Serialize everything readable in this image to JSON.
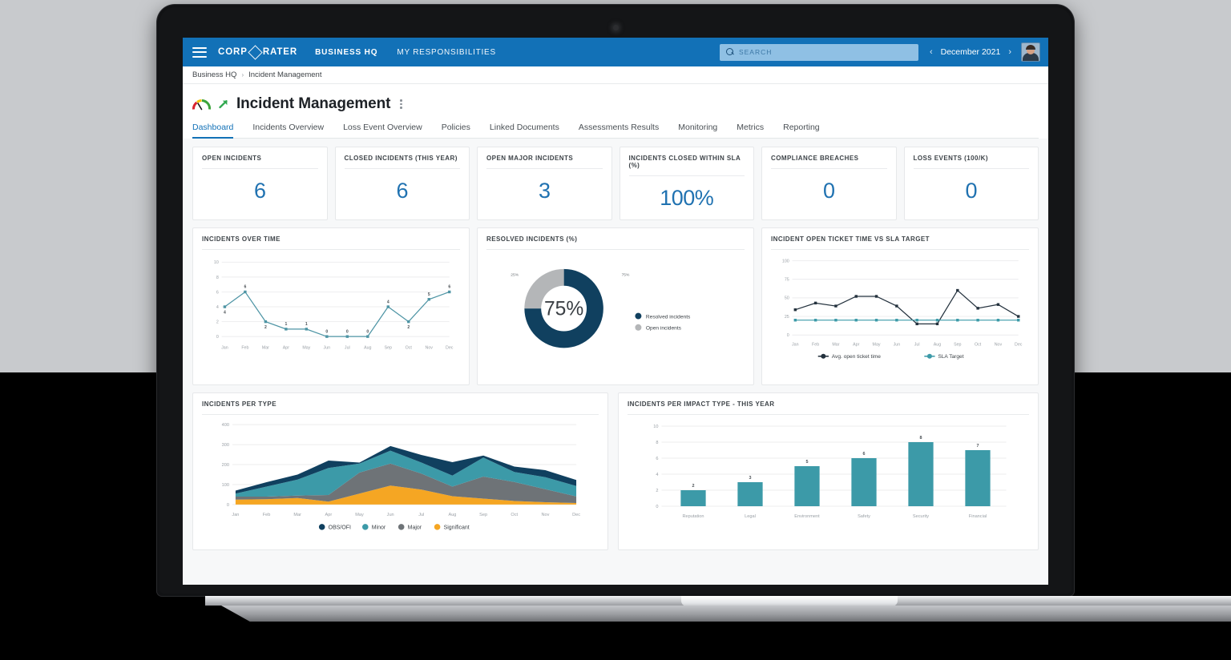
{
  "topbar": {
    "menu_icon": "hamburger-icon",
    "brand": "CORPORATER",
    "nav": [
      {
        "label": "BUSINESS HQ"
      },
      {
        "label": "MY RESPONSIBILITIES"
      }
    ],
    "search": {
      "placeholder": "SEARCH",
      "value": "",
      "icon": "search-icon"
    },
    "period": {
      "prev_icon": "‹",
      "label": "December 2021",
      "next_icon": "›"
    },
    "avatar": "user-avatar"
  },
  "breadcrumb": {
    "root": "Business HQ",
    "separator": "›",
    "current": "Incident Management"
  },
  "header": {
    "title": "Incident Management",
    "gauge_icon": "gauge-icon",
    "trend_icon": "arrow-up-right-icon",
    "menu_icon": "kebab-menu-icon"
  },
  "tabs": [
    {
      "label": "Dashboard",
      "active": true
    },
    {
      "label": "Incidents Overview",
      "active": false
    },
    {
      "label": "Loss Event Overview",
      "active": false
    },
    {
      "label": "Policies",
      "active": false
    },
    {
      "label": "Linked Documents",
      "active": false
    },
    {
      "label": "Assessments Results",
      "active": false
    },
    {
      "label": "Monitoring",
      "active": false
    },
    {
      "label": "Metrics",
      "active": false
    },
    {
      "label": "Reporting",
      "active": false
    }
  ],
  "kpis": [
    {
      "label": "OPEN INCIDENTS",
      "value": "6"
    },
    {
      "label": "CLOSED INCIDENTS (THIS YEAR)",
      "value": "6"
    },
    {
      "label": "OPEN MAJOR INCIDENTS",
      "value": "3"
    },
    {
      "label": "INCIDENTS CLOSED WITHIN SLA (%)",
      "value": "100%"
    },
    {
      "label": "COMPLIANCE BREACHES",
      "value": "0"
    },
    {
      "label": "LOSS EVENTS (100/K)",
      "value": "0"
    }
  ],
  "colors": {
    "brand_blue": "#1271b7",
    "kpi_value": "#2072b1",
    "navy": "#10405f",
    "teal": "#3c9aa8",
    "gray": "#b4b6b8",
    "dark_gray": "#6e7377",
    "amber": "#f5a623",
    "line_teal": "#4d94a4",
    "line_navy": "#23313d"
  },
  "chart_data": [
    {
      "id": "incidents-over-time",
      "type": "line",
      "title": "INCIDENTS OVER TIME",
      "categories": [
        "Jan",
        "Feb",
        "Mar",
        "Apr",
        "May",
        "Jun",
        "Jul",
        "Aug",
        "Sep",
        "Oct",
        "Nov",
        "Dec"
      ],
      "values": [
        4,
        6,
        2,
        1,
        1,
        0,
        0,
        0,
        4,
        2,
        5,
        6
      ],
      "data_labels": [
        "4",
        "6",
        "2",
        "1",
        "1",
        "0",
        "0",
        "0",
        "4",
        "2",
        "5",
        "6"
      ],
      "yticks": [
        0,
        2,
        4,
        6,
        8,
        10
      ],
      "ylim": [
        0,
        10
      ],
      "xlabel": "",
      "ylabel": "",
      "grid": true,
      "series_color": "#4d94a4",
      "legend": false
    },
    {
      "id": "resolved-incidents",
      "type": "pie",
      "title": "RESOLVED INCIDENTS (%)",
      "center_label": "75%",
      "slices": [
        {
          "name": "Resolved incidents",
          "value": 75,
          "label": "75%",
          "color": "#10405f"
        },
        {
          "name": "Open incidents",
          "value": 25,
          "label": "25%",
          "color": "#b4b6b8"
        }
      ],
      "legend": [
        "Resolved incidents",
        "Open incidents"
      ],
      "legend_position": "right"
    },
    {
      "id": "open-ticket-vs-sla",
      "type": "line",
      "title": "INCIDENT OPEN TICKET TIME VS SLA TARGET",
      "categories": [
        "Jan",
        "Feb",
        "Mar",
        "Apr",
        "May",
        "Jun",
        "Jul",
        "Aug",
        "Sep",
        "Oct",
        "Nov",
        "Dec"
      ],
      "series": [
        {
          "name": "Avg. open ticket time",
          "color": "#23313d",
          "values": [
            34,
            43,
            39,
            52,
            52,
            39,
            15,
            15,
            60,
            36,
            41,
            25
          ]
        },
        {
          "name": "SLA Target",
          "color": "#3c9aa8",
          "values": [
            20,
            20,
            20,
            20,
            20,
            20,
            20,
            20,
            20,
            20,
            20,
            20
          ]
        }
      ],
      "yticks": [
        0,
        25,
        50,
        75,
        100
      ],
      "ylim": [
        0,
        100
      ],
      "grid": true,
      "legend": [
        "Avg. open ticket time",
        "SLA Target"
      ],
      "legend_position": "bottom"
    },
    {
      "id": "incidents-per-type",
      "type": "area",
      "title": "INCIDENTS PER TYPE",
      "categories": [
        "Jan",
        "Feb",
        "Mar",
        "Apr",
        "May",
        "Jun",
        "Jul",
        "Aug",
        "Sep",
        "Oct",
        "Nov",
        "Dec"
      ],
      "stacked": true,
      "series": [
        {
          "name": "Significant",
          "color": "#f5a623",
          "values": [
            25,
            27,
            33,
            15,
            55,
            95,
            75,
            42,
            30,
            18,
            12,
            8
          ]
        },
        {
          "name": "Major",
          "color": "#6e7377",
          "values": [
            15,
            13,
            12,
            33,
            105,
            110,
            80,
            48,
            110,
            95,
            65,
            33
          ]
        },
        {
          "name": "Minor",
          "color": "#3c9aa8",
          "values": [
            15,
            50,
            80,
            135,
            45,
            65,
            55,
            55,
            95,
            50,
            60,
            52
          ]
        },
        {
          "name": "OBS/OFI",
          "color": "#10405f",
          "values": [
            15,
            22,
            25,
            37,
            5,
            23,
            38,
            67,
            10,
            27,
            35,
            30
          ]
        }
      ],
      "yticks": [
        0,
        100,
        200,
        300,
        400
      ],
      "ylim": [
        0,
        400
      ],
      "grid": true,
      "legend": [
        "OBS/OFI",
        "Minor",
        "Major",
        "Significant"
      ],
      "legend_position": "bottom"
    },
    {
      "id": "incidents-per-impact-type",
      "type": "bar",
      "title": "INCIDENTS PER IMPACT TYPE - THIS YEAR",
      "categories": [
        "Reputation",
        "Legal",
        "Environment",
        "Safety",
        "Security",
        "Financial"
      ],
      "values": [
        2,
        3,
        5,
        6,
        8,
        7
      ],
      "data_labels": [
        "2",
        "3",
        "5",
        "6",
        "8",
        "7"
      ],
      "yticks": [
        0,
        2,
        4,
        6,
        8,
        10
      ],
      "ylim": [
        0,
        10
      ],
      "grid": true,
      "bar_color": "#3c9aa8",
      "legend": false
    }
  ]
}
